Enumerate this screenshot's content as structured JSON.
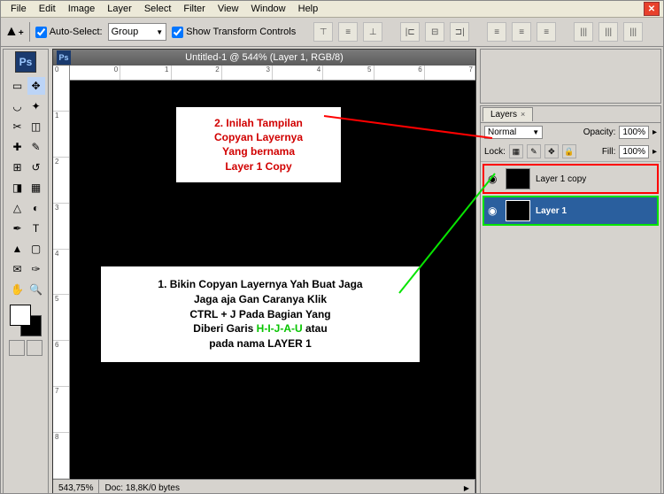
{
  "menubar": {
    "file": "File",
    "edit": "Edit",
    "image": "Image",
    "layer": "Layer",
    "select": "Select",
    "filter": "Filter",
    "view": "View",
    "window": "Window",
    "help": "Help"
  },
  "optbar": {
    "auto_select": "Auto-Select:",
    "group": "Group",
    "show_transform": "Show Transform Controls"
  },
  "doc": {
    "title": "Untitled-1 @ 544% (Layer 1, RGB/8)",
    "hruler": [
      "0",
      "1",
      "2",
      "3",
      "4",
      "5",
      "6",
      "7"
    ],
    "vruler": [
      "0",
      "1",
      "2",
      "3",
      "4",
      "5",
      "6",
      "7",
      "8"
    ],
    "note1_l1": "2. Inilah Tampilan",
    "note1_l2": "Copyan Layernya",
    "note1_l3": "Yang bernama",
    "note1_l4": "Layer 1 Copy",
    "note2_l1": "1. Bikin Copyan Layernya Yah Buat Jaga",
    "note2_l2": "Jaga aja Gan Caranya Klik",
    "note2_l3": "CTRL + J Pada Bagian Yang",
    "note2_l4a": "Diberi Garis ",
    "note2_hijau": "H-I-J-A-U",
    "note2_l4b": " atau",
    "note2_l5": "pada nama LAYER 1",
    "zoom": "543,75%",
    "docinfo": "Doc: 18,8K/0 bytes"
  },
  "layers_panel": {
    "tab": "Layers",
    "blend": "Normal",
    "opacity_label": "Opacity:",
    "opacity_value": "100%",
    "lock_label": "Lock:",
    "fill_label": "Fill:",
    "fill_value": "100%",
    "layer_copy": "Layer 1 copy",
    "layer_1": "Layer 1"
  },
  "ps": "Ps"
}
